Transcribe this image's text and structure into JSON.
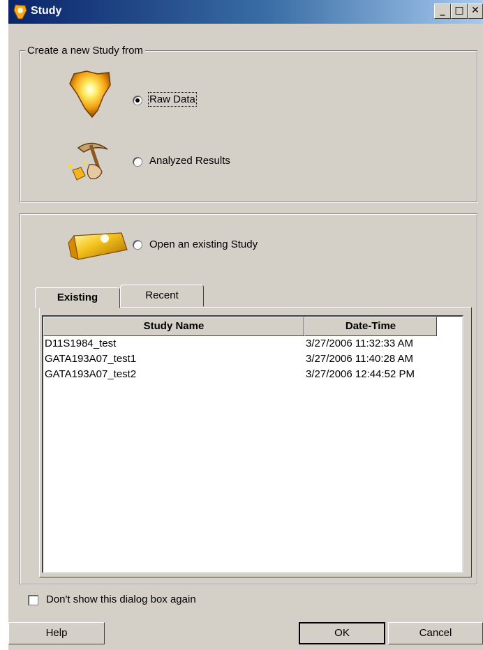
{
  "window": {
    "title": "Study"
  },
  "create_group": {
    "label": "Create a new Study from"
  },
  "options": {
    "raw_data": {
      "label": "Raw Data",
      "selected": true
    },
    "analyzed_results": {
      "label": "Analyzed Results",
      "selected": false
    },
    "open_existing": {
      "label": "Open an existing Study",
      "selected": false
    }
  },
  "tabs": [
    {
      "label": "Existing",
      "active": true
    },
    {
      "label": "Recent",
      "active": false
    }
  ],
  "table": {
    "columns": [
      "Study Name",
      "Date-Time"
    ],
    "rows": [
      [
        "D11S1984_test",
        "3/27/2006 11:32:33 AM"
      ],
      [
        "GATA193A07_test1",
        "3/27/2006 11:40:28 AM"
      ],
      [
        "GATA193A07_test2",
        "3/27/2006 12:44:52 PM"
      ]
    ]
  },
  "dont_show": {
    "label": "Don't show this dialog box again",
    "checked": false
  },
  "buttons": {
    "help": "Help",
    "ok": "OK",
    "cancel": "Cancel"
  },
  "icons": {
    "title": "study-app-icon",
    "raw_data": "gold-nugget-icon",
    "analyzed_results": "pickaxe-gold-icon",
    "open_existing": "gold-bar-icon"
  },
  "colors": {
    "face": "#d4d0c8",
    "title_start": "#0a246a",
    "title_end": "#a6caf0",
    "gold": "#f5b41e"
  }
}
